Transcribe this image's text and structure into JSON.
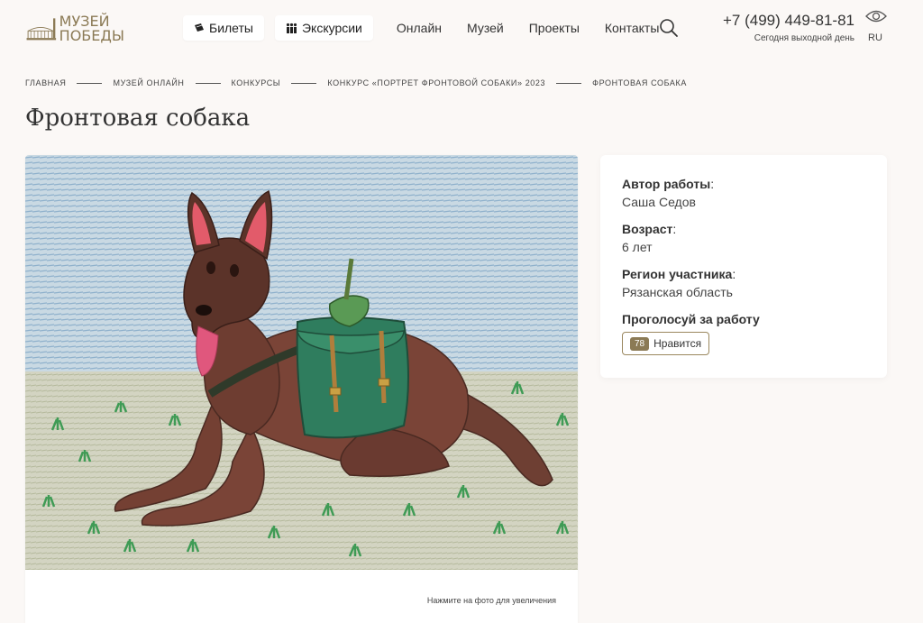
{
  "header": {
    "logo": {
      "line1": "МУЗЕЙ",
      "line2": "ПОБЕДЫ"
    },
    "nav": [
      {
        "label": "Билеты",
        "style": "pill",
        "icon": "ticket-icon"
      },
      {
        "label": "Экскурсии",
        "style": "pill",
        "icon": "people-icon"
      },
      {
        "label": "Онлайн",
        "style": "link"
      },
      {
        "label": "Музей",
        "style": "link"
      },
      {
        "label": "Проекты",
        "style": "link"
      },
      {
        "label": "Контакты",
        "style": "link"
      }
    ],
    "phone": "+7 (499) 449-81-81",
    "hours": "Сегодня выходной день",
    "lang": "RU"
  },
  "breadcrumb": [
    "Главная",
    "Музей онлайн",
    "Конкурсы",
    "Конкурс «Портрет фронтовой собаки» 2023",
    "Фронтовая собака"
  ],
  "page_title": "Фронтовая собака",
  "image": {
    "hint": "Нажмите на фото для увеличения"
  },
  "info": {
    "author_label": "Автор работы",
    "author_value": "Саша Седов",
    "age_label": "Возраст",
    "age_value": "6 лет",
    "region_label": "Регион участника",
    "region_value": "Рязанская область",
    "vote_title": "Проголосуй за работу",
    "likes_count": "78",
    "likes_label": "Нравится"
  },
  "colors": {
    "background": "#fbf8f6",
    "accent": "#8b7a55"
  }
}
